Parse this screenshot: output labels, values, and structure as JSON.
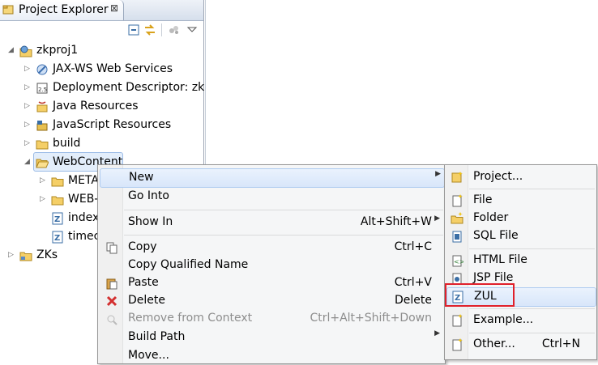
{
  "explorer": {
    "tab_label": "Project Explorer",
    "tab_close": "⊠",
    "toolbar": [
      {
        "name": "collapse-all-icon"
      },
      {
        "name": "link-with-editor-icon"
      },
      {
        "name": "filters-icon"
      },
      {
        "name": "view-menu-icon"
      }
    ],
    "tree": [
      {
        "label": "zkproj1",
        "expander": "◢",
        "icon": "web-project-icon"
      },
      {
        "label": "JAX-WS Web Services",
        "expander": "▷",
        "icon": "webservices-icon"
      },
      {
        "label": "Deployment Descriptor: zkp",
        "expander": "▷",
        "icon": "deployment-descriptor-icon"
      },
      {
        "label": "Java Resources",
        "expander": "▷",
        "icon": "java-resources-icon"
      },
      {
        "label": "JavaScript Resources",
        "expander": "▷",
        "icon": "javascript-resources-icon"
      },
      {
        "label": "build",
        "expander": "▷",
        "icon": "folder-icon"
      },
      {
        "label": "WebContent",
        "expander": "◢",
        "icon": "folder-open-icon"
      },
      {
        "label": "META",
        "expander": "▷",
        "icon": "folder-icon"
      },
      {
        "label": "WEB-",
        "expander": "▷",
        "icon": "folder-icon"
      },
      {
        "label": "index",
        "expander": "",
        "icon": "zul-file-icon"
      },
      {
        "label": "timec",
        "expander": "",
        "icon": "zul-file-icon"
      },
      {
        "label": "ZKs",
        "expander": "▷",
        "icon": "project-folder-icon"
      }
    ]
  },
  "context_menu": {
    "items": [
      {
        "label": "New",
        "shortcut": "",
        "submenu": "▶",
        "icon": ""
      },
      {
        "label": "Go Into",
        "shortcut": "",
        "submenu": "",
        "icon": ""
      },
      {
        "label": "Show In",
        "shortcut": "Alt+Shift+W",
        "submenu": "▶",
        "icon": ""
      },
      {
        "label": "Copy",
        "shortcut": "Ctrl+C",
        "submenu": "",
        "icon": "copy-icon"
      },
      {
        "label": "Copy Qualified Name",
        "shortcut": "",
        "submenu": "",
        "icon": ""
      },
      {
        "label": "Paste",
        "shortcut": "Ctrl+V",
        "submenu": "",
        "icon": "paste-icon"
      },
      {
        "label": "Delete",
        "shortcut": "Delete",
        "submenu": "",
        "icon": "delete-icon"
      },
      {
        "label": "Remove from Context",
        "shortcut": "Ctrl+Alt+Shift+Down",
        "submenu": "",
        "icon": "remove-context-icon"
      },
      {
        "label": "Build Path",
        "shortcut": "",
        "submenu": "▶",
        "icon": ""
      },
      {
        "label": "Move...",
        "shortcut": "",
        "submenu": "",
        "icon": ""
      }
    ]
  },
  "submenu": {
    "items": [
      {
        "label": "Project...",
        "shortcut": "",
        "icon": "new-project-icon"
      },
      {
        "label": "File",
        "shortcut": "",
        "icon": "new-file-icon"
      },
      {
        "label": "Folder",
        "shortcut": "",
        "icon": "new-folder-icon"
      },
      {
        "label": "SQL File",
        "shortcut": "",
        "icon": "sql-file-icon"
      },
      {
        "label": "HTML File",
        "shortcut": "",
        "icon": "html-file-icon"
      },
      {
        "label": "JSP File",
        "shortcut": "",
        "icon": "jsp-file-icon"
      },
      {
        "label": "ZUL",
        "shortcut": "",
        "icon": "zul-file-icon"
      },
      {
        "label": "Example...",
        "shortcut": "",
        "icon": "example-icon"
      },
      {
        "label": "Other...",
        "shortcut": "Ctrl+N",
        "icon": "other-wizard-icon"
      }
    ]
  }
}
